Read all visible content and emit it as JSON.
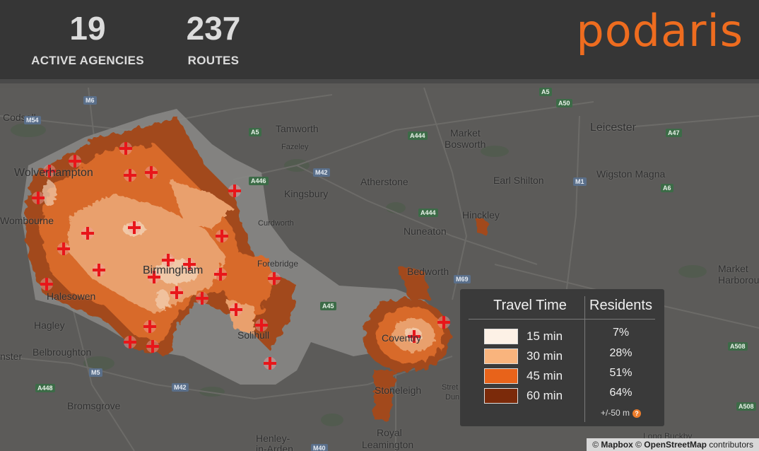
{
  "header": {
    "agencies_count": "19",
    "agencies_label": "ACTIVE AGENCIES",
    "routes_count": "237",
    "routes_label": "ROUTES",
    "logo_text": "podaris"
  },
  "map": {
    "places": [
      {
        "name": "Codsall"
      },
      {
        "name": "Wolverhampton"
      },
      {
        "name": "Wombourne"
      },
      {
        "name": "Tamworth"
      },
      {
        "name": "Fazeley"
      },
      {
        "name": "Kingsbury"
      },
      {
        "name": "Curdworth"
      },
      {
        "name": "Market"
      },
      {
        "name": "Bosworth"
      },
      {
        "name": "Leicester"
      },
      {
        "name": "Atherstone"
      },
      {
        "name": "Earl Shilton"
      },
      {
        "name": "Wigston Magna"
      },
      {
        "name": "Hinckley"
      },
      {
        "name": "Nuneaton"
      },
      {
        "name": "Forebridge"
      },
      {
        "name": "Birmingham"
      },
      {
        "name": "Bedworth"
      },
      {
        "name": "Market"
      },
      {
        "name": "Harborough"
      },
      {
        "name": "Halesowen"
      },
      {
        "name": "Hagley"
      },
      {
        "name": "nster"
      },
      {
        "name": "Belbroughton"
      },
      {
        "name": "Bromsgrove"
      },
      {
        "name": "Coventry"
      },
      {
        "name": "Stoneleigh"
      },
      {
        "name": "Royal"
      },
      {
        "name": "Leamington"
      },
      {
        "name": "Henley-"
      },
      {
        "name": "in-Arden"
      },
      {
        "name": "Stret"
      },
      {
        "name": "Dun"
      },
      {
        "name": "Long Buckby"
      },
      {
        "name": "Solihull"
      }
    ],
    "roads": [
      {
        "name": "M54"
      },
      {
        "name": "M6"
      },
      {
        "name": "A5"
      },
      {
        "name": "A444"
      },
      {
        "name": "A50"
      },
      {
        "name": "A47"
      },
      {
        "name": "M42"
      },
      {
        "name": "A446"
      },
      {
        "name": "M1"
      },
      {
        "name": "A6"
      },
      {
        "name": "A444"
      },
      {
        "name": "M69"
      },
      {
        "name": "A45"
      },
      {
        "name": "M5"
      },
      {
        "name": "A448"
      },
      {
        "name": "M42"
      },
      {
        "name": "A508"
      },
      {
        "name": "A508"
      },
      {
        "name": "M40"
      },
      {
        "name": "A5"
      }
    ]
  },
  "legend": {
    "title_time": "Travel Time",
    "title_residents": "Residents",
    "rows": [
      {
        "label": "15 min",
        "pct": "7%",
        "color": "#fdf1e6"
      },
      {
        "label": "30 min",
        "pct": "28%",
        "color": "#f9b47d"
      },
      {
        "label": "45 min",
        "pct": "51%",
        "color": "#e8631a"
      },
      {
        "label": "60 min",
        "pct": "64%",
        "color": "#7b2a0a"
      }
    ],
    "note": "+/-50 m",
    "help_icon": "question-icon"
  },
  "attribution": {
    "prefix": "© ",
    "mapbox": "Mapbox",
    "mid": " © ",
    "osm": "OpenStreetMap",
    "suffix": " contributors"
  }
}
